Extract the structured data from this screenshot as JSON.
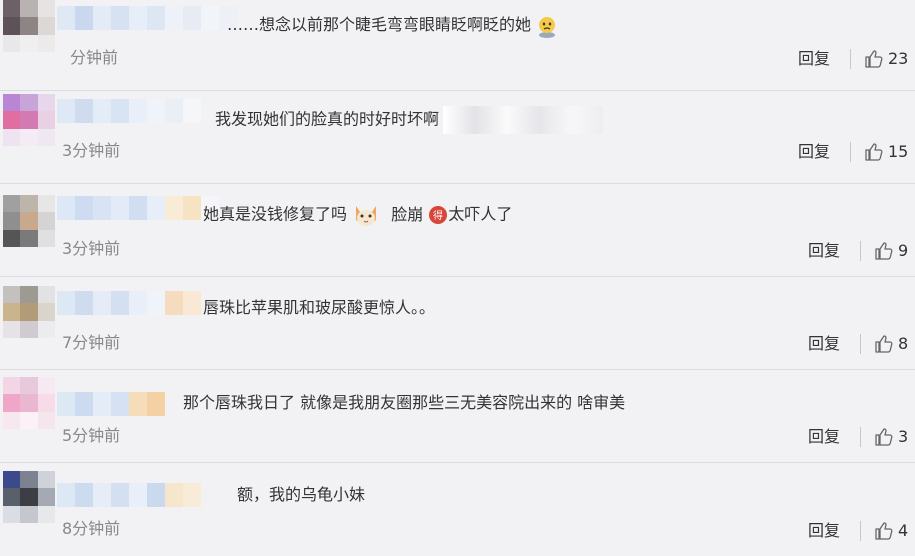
{
  "comments": [
    {
      "text": "……想念以前那个睫毛弯弯眼睛眨啊眨的她",
      "time": "分钟前",
      "reply": "回复",
      "likes": "23",
      "avatar_colors": [
        "#6b6166",
        "#b8b3b0",
        "#e6e3e2",
        "#5d5257",
        "#8d8486",
        "#dcd8d6",
        "#e8e8ea",
        "#f0eff0",
        "#eceaeb"
      ],
      "nick_colors": [
        "#dfe8f5",
        "#c9d8ee",
        "#e3ebf6",
        "#d6e2f2",
        "#e8eef7",
        "#dde6f3",
        "#eef2f8",
        "#e7ecf4",
        "#f1f4f9",
        "#edf0f6"
      ]
    },
    {
      "text": "我发现她们的脸真的时好时坏啊",
      "time": "3分钟前",
      "reply": "回复",
      "likes": "15",
      "avatar_colors": [
        "#b986d6",
        "#c9a4d8",
        "#e7d6ec",
        "#e06ea0",
        "#d47ab2",
        "#ead0e3",
        "#eee3f1",
        "#f4ecf5",
        "#efe8f2"
      ],
      "nick_colors": [
        "#dfe9f6",
        "#cfdcf0",
        "#e4ecf7",
        "#d9e4f3",
        "#e9eff8",
        "#f0f3f9",
        "#eaeef5",
        "#f4f6fa"
      ]
    },
    {
      "text": "她真是没钱修复了吗",
      "text2": "脸崩",
      "text3": "太吓人了",
      "time": "3分钟前",
      "reply": "回复",
      "likes": "9",
      "avatar_colors": [
        "#a0a0a0",
        "#bdb5a9",
        "#e6e6e6",
        "#8f8f8f",
        "#c8a98d",
        "#d4d4d4",
        "#555555",
        "#7a7a7a",
        "#e0e0e0"
      ],
      "nick_colors": [
        "#dce8f6",
        "#cddcf1",
        "#d8e3f3",
        "#e3ebf6",
        "#d1def1",
        "#e8eef7",
        "#f9ecd6",
        "#f6e3c2",
        "#f3f5f9"
      ]
    },
    {
      "text": "唇珠比苹果肌和玻尿酸更惊人。。",
      "time": "7分钟前",
      "reply": "回复",
      "likes": "8",
      "avatar_colors": [
        "#c4c0bd",
        "#9d9993",
        "#e2e1e3",
        "#c9b48e",
        "#b19b78",
        "#d9d5cc",
        "#e5e3e6",
        "#cfcbd0",
        "#ececee"
      ],
      "nick_colors": [
        "#dde8f5",
        "#cfdcf0",
        "#e5ecf7",
        "#d4e0f2",
        "#e9eff8",
        "#f0f3f9",
        "#f6dcbf",
        "#f9e8d3"
      ]
    },
    {
      "text": "那个唇珠我日了 就像是我朋友圈那些三无美容院出来的 啥审美",
      "time": "5分钟前",
      "reply": "回复",
      "likes": "3",
      "avatar_colors": [
        "#f2d6e6",
        "#e8c8dc",
        "#f7e9f1",
        "#f0a6c8",
        "#eab7d0",
        "#f6dce9",
        "#f7e8ef",
        "#fbf1f6",
        "#f5e6ee"
      ],
      "nick_colors": [
        "#dde8f5",
        "#cddbf0",
        "#e4ecf7",
        "#d6e2f3",
        "#f6ddb9",
        "#f3d1a4"
      ]
    },
    {
      "text": "额，我的乌龟小妹",
      "time": "8分钟前",
      "reply": "回复",
      "likes": "4",
      "avatar_colors": [
        "#3c4a8c",
        "#7d8290",
        "#cfd2d8",
        "#5a5f6c",
        "#3d3e45",
        "#a5a9b3",
        "#dadde3",
        "#c4c7cd",
        "#e7e8eb"
      ],
      "nick_colors": [
        "#dde8f5",
        "#cddbf0",
        "#e6edf7",
        "#d4e0f2",
        "#e9eff8",
        "#cbd9ef",
        "#f6e6cc",
        "#f8ecd9"
      ]
    }
  ]
}
